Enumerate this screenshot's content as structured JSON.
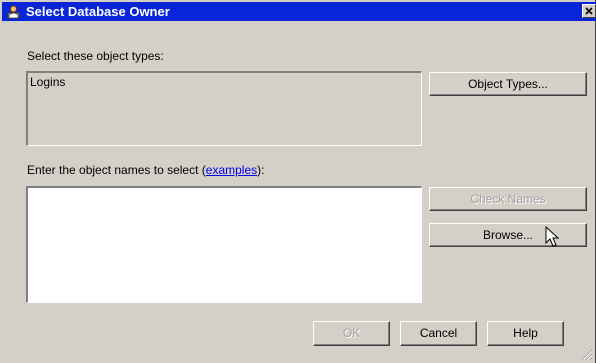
{
  "window": {
    "title": "Select Database Owner",
    "close_icon": "close-icon",
    "app_icon": "database-owner-icon"
  },
  "object_types": {
    "label": "Select these object types:",
    "value": "Logins",
    "button_label": "Object Types..."
  },
  "object_names": {
    "label_prefix": "Enter the object names to select (",
    "label_link": "examples",
    "label_suffix": "):",
    "value": "",
    "check_names_label": "Check Names",
    "browse_label": "Browse..."
  },
  "footer": {
    "ok_label": "OK",
    "cancel_label": "Cancel",
    "help_label": "Help"
  },
  "colors": {
    "titlebar": "#0a24d8",
    "dialog_bg": "#d4d0c8",
    "link": "#0000ee",
    "disabled_text": "#a0a0a0"
  }
}
